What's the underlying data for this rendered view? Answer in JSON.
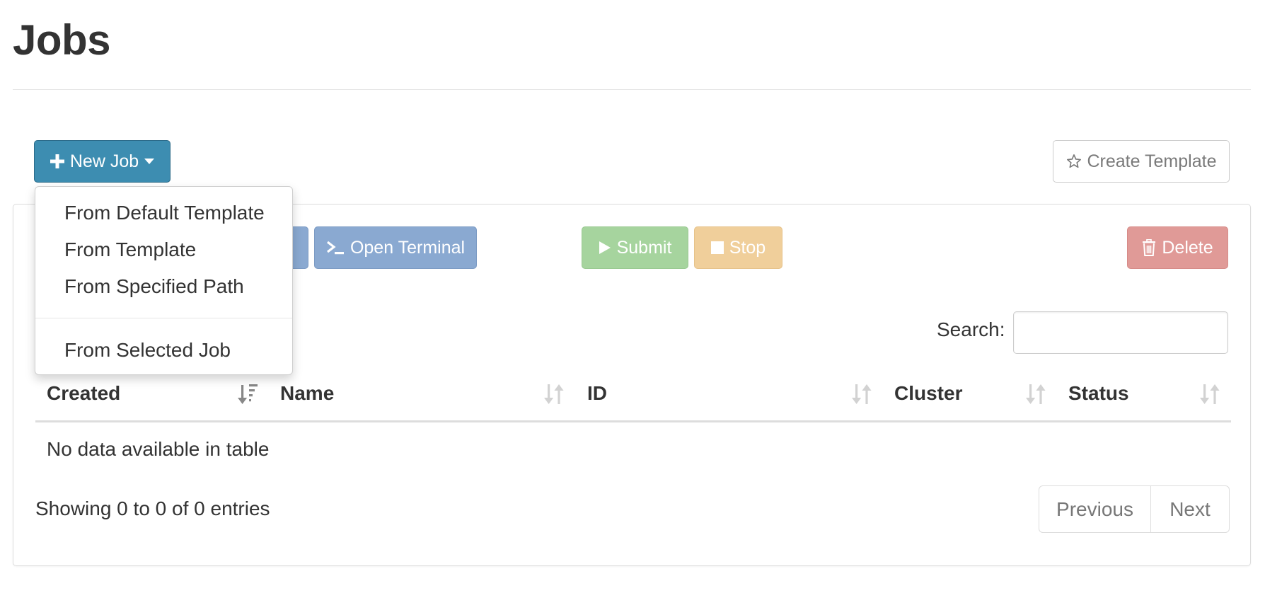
{
  "page": {
    "title": "Jobs"
  },
  "toolbar": {
    "new_job": "New Job",
    "create_template": "Create Template",
    "open_terminal": "Open Terminal",
    "submit": "Submit",
    "stop": "Stop",
    "delete": "Delete"
  },
  "new_job_menu": {
    "items": [
      "From Default Template",
      "From Template",
      "From Specified Path",
      "From Selected Job"
    ]
  },
  "search": {
    "label": "Search:",
    "value": ""
  },
  "table": {
    "columns": [
      "Created",
      "Name",
      "ID",
      "Cluster",
      "Status"
    ],
    "empty_message": "No data available in table",
    "info": "Showing 0 to 0 of 0 entries"
  },
  "pagination": {
    "previous": "Previous",
    "next": "Next"
  },
  "colors": {
    "primary": "#3d8db1",
    "info": "#8aa9d1",
    "success": "#a6d49e",
    "warning": "#f0cf9b",
    "danger": "#e09a97"
  },
  "icons": {
    "new_job": "plus-icon",
    "dropdown": "caret-down-icon",
    "create_template": "star-outline-icon",
    "open_terminal": "terminal-icon",
    "submit": "play-icon",
    "stop": "stop-icon",
    "delete": "trash-icon",
    "sort_active": "sort-desc-icon",
    "sort": "sort-icon"
  }
}
